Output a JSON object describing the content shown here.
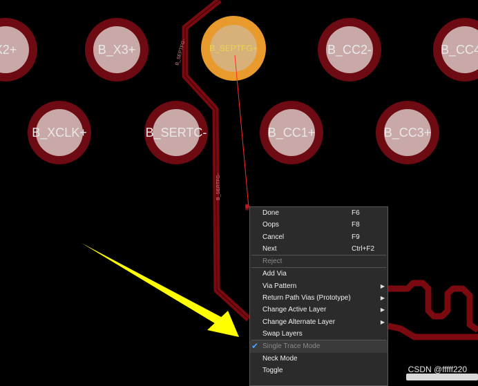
{
  "pads": {
    "row1": [
      "X2+",
      "B_X3+",
      "B_SEPTFG+",
      "B_CC2-",
      "B_CC4"
    ],
    "row2": [
      "B_XCLK+",
      "B_SERTC-",
      "B_CC1+",
      "B_CC3+"
    ]
  },
  "trace_labels": [
    "B_SEPTFG-",
    "B_SERTFG-"
  ],
  "colors": {
    "background": "#000000",
    "trace": "#7a0a10",
    "pad_outer": "#6e0a12",
    "pad_inner": "#c8a9a8",
    "selected_pad": "#e89a2c",
    "ratsnest": "#ff2a2a",
    "arrow": "#ffff00",
    "menu_bg": "#2b2b2b"
  },
  "context_menu": {
    "items": [
      {
        "label": "Done",
        "shortcut": "F6"
      },
      {
        "label": "Oops",
        "shortcut": "F8"
      },
      {
        "label": "Cancel",
        "shortcut": "F9"
      },
      {
        "label": "Next",
        "shortcut": "Ctrl+F2"
      },
      {
        "label": "Reject"
      },
      {
        "label": "Add Via"
      },
      {
        "label": "Via Pattern"
      },
      {
        "label": "Return Path Vias (Prototype)"
      },
      {
        "label": "Change Active Layer"
      },
      {
        "label": "Change Alternate Layer"
      },
      {
        "label": "Swap Layers"
      },
      {
        "label": "Single Trace Mode"
      },
      {
        "label": "Neck Mode"
      },
      {
        "label": "Toggle"
      }
    ]
  },
  "watermark": "CSDN @fffff220"
}
